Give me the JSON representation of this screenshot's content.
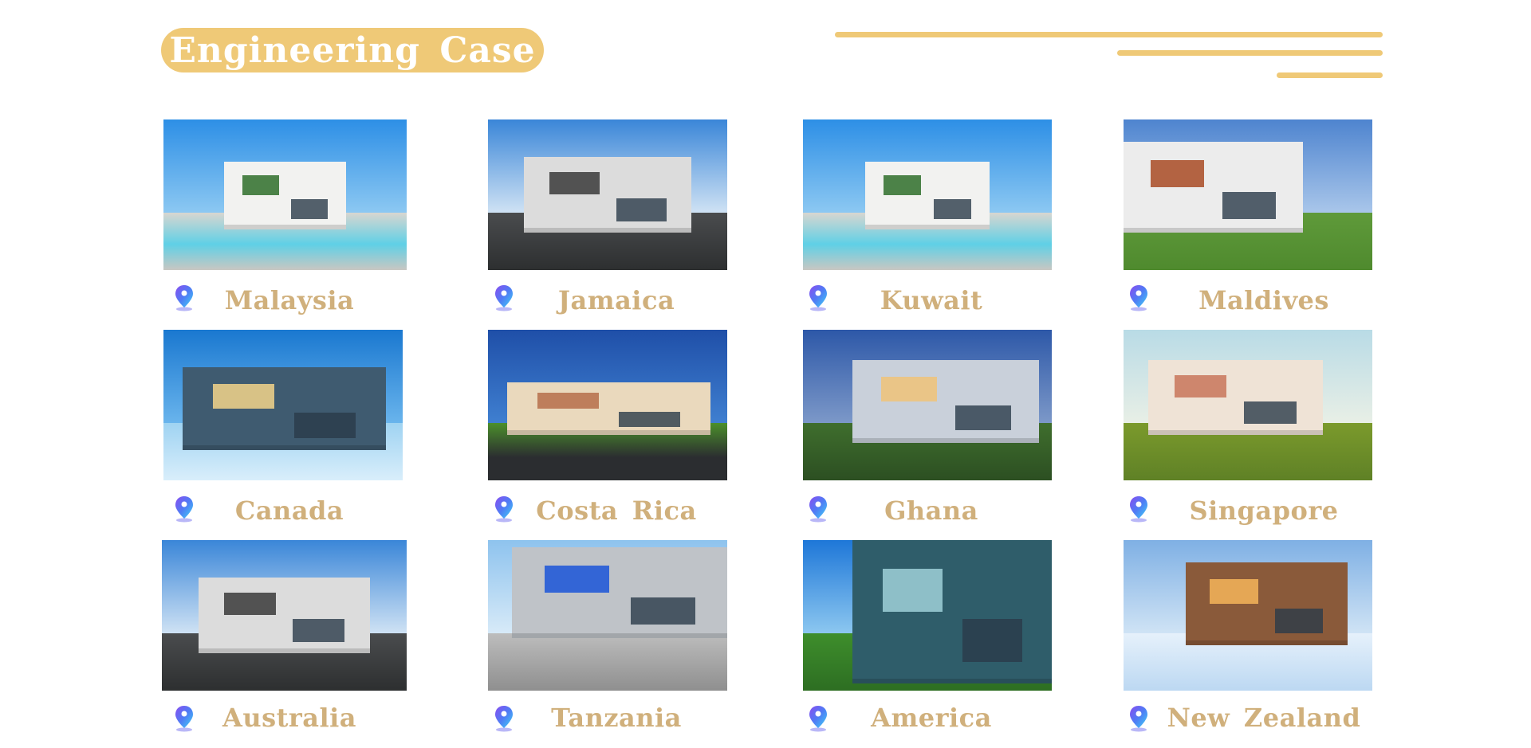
{
  "header": {
    "title": "Engineering Case",
    "accent_color": "#efc977",
    "label_color": "#d0b07c"
  },
  "cases": [
    {
      "country": "Malaysia",
      "scene": "white-villa-with-pool",
      "icon": "location-pin-icon"
    },
    {
      "country": "Jamaica",
      "scene": "modern-house-with-fence",
      "icon": "location-pin-icon"
    },
    {
      "country": "Kuwait",
      "scene": "white-villa-with-pool",
      "icon": "location-pin-icon"
    },
    {
      "country": "Maldives",
      "scene": "modern-house-wood-facade",
      "icon": "location-pin-icon"
    },
    {
      "country": "Canada",
      "scene": "glass-house-snow",
      "icon": "location-pin-icon"
    },
    {
      "country": "Costa Rica",
      "scene": "suburban-houses",
      "icon": "location-pin-icon"
    },
    {
      "country": "Ghana",
      "scene": "modern-house-dusk",
      "icon": "location-pin-icon"
    },
    {
      "country": "Singapore",
      "scene": "villa-with-garden",
      "icon": "location-pin-icon"
    },
    {
      "country": "Australia",
      "scene": "modern-house-with-fence",
      "icon": "location-pin-icon"
    },
    {
      "country": "Tanzania",
      "scene": "commercial-glass-building",
      "icon": "location-pin-icon"
    },
    {
      "country": "America",
      "scene": "glass-apartment-towers",
      "icon": "location-pin-icon"
    },
    {
      "country": "New Zealand",
      "scene": "chalet-in-snow",
      "icon": "location-pin-icon"
    }
  ]
}
